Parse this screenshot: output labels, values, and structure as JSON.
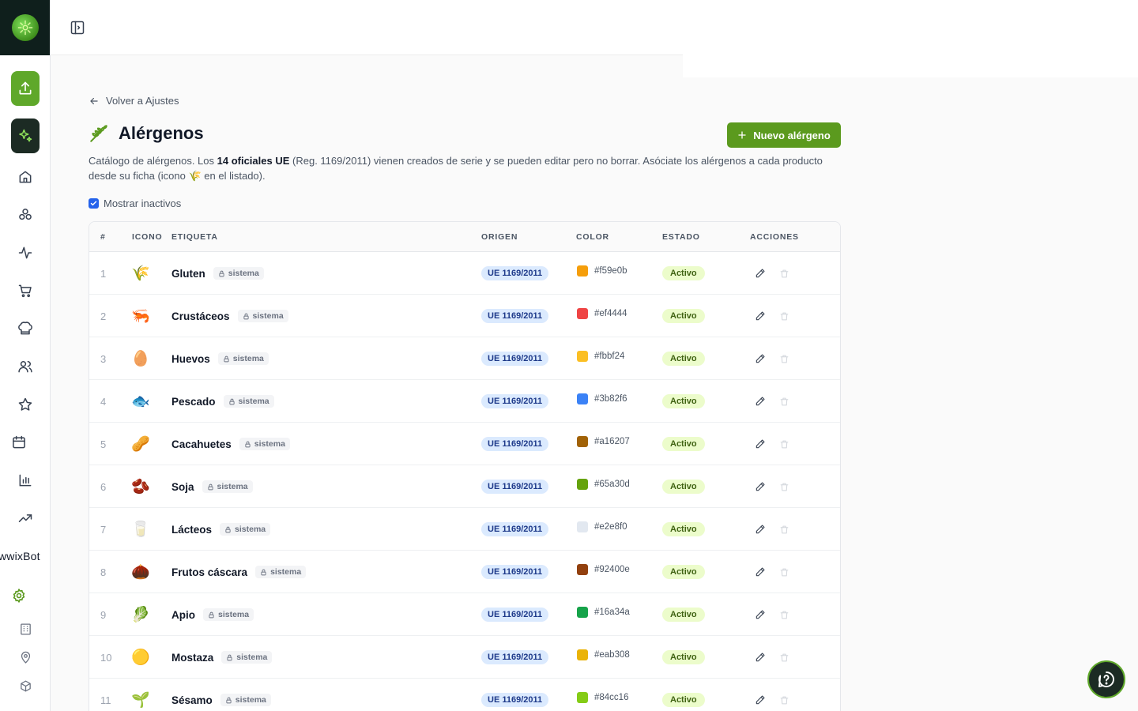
{
  "sidebar": {
    "brand_text": "wwixBot",
    "icons": [
      "upload-icon",
      "sparkles-icon",
      "home-icon",
      "boxes-icon",
      "activity-icon",
      "cart-icon",
      "chef-hat-icon",
      "users-icon",
      "star-icon",
      "calendar-icon",
      "bar-chart-icon",
      "trending-up-icon",
      "settings-icon",
      "building-icon",
      "location-pin-icon",
      "package-icon"
    ]
  },
  "main": {
    "back_label": "Volver a Ajustes",
    "title": "Alérgenos",
    "new_button_label": "Nuevo alérgeno",
    "description": {
      "part1": "Catálogo de alérgenos. Los ",
      "bold": "14 oficiales UE",
      "part2": " (Reg. 1169/2011) vienen creados de serie y se pueden editar pero no borrar. Asóciate los alérgenos a cada producto desde su ficha (icono ",
      "part3": " en el listado)."
    },
    "show_inactive_label": "Mostrar inactivos",
    "show_inactive_checked": true
  },
  "table": {
    "headers": {
      "num": "#",
      "icon": "ICONO",
      "label": "ETIQUETA",
      "origin": "ORIGEN",
      "color": "COLOR",
      "status": "ESTADO",
      "actions": "ACCIONES"
    },
    "rows": [
      {
        "num": "1",
        "emoji": "🌾",
        "label": "Gluten",
        "badge": "sistema",
        "origin": "UE 1169/2011",
        "color": "#f59e0b",
        "status": "Activo"
      },
      {
        "num": "2",
        "emoji": "🦐",
        "label": "Crustáceos",
        "badge": "sistema",
        "origin": "UE 1169/2011",
        "color": "#ef4444",
        "status": "Activo"
      },
      {
        "num": "3",
        "emoji": "🥚",
        "label": "Huevos",
        "badge": "sistema",
        "origin": "UE 1169/2011",
        "color": "#fbbf24",
        "status": "Activo"
      },
      {
        "num": "4",
        "emoji": "🐟",
        "label": "Pescado",
        "badge": "sistema",
        "origin": "UE 1169/2011",
        "color": "#3b82f6",
        "status": "Activo"
      },
      {
        "num": "5",
        "emoji": "🥜",
        "label": "Cacahuetes",
        "badge": "sistema",
        "origin": "UE 1169/2011",
        "color": "#a16207",
        "status": "Activo"
      },
      {
        "num": "6",
        "emoji": "🫘",
        "label": "Soja",
        "badge": "sistema",
        "origin": "UE 1169/2011",
        "color": "#65a30d",
        "status": "Activo"
      },
      {
        "num": "7",
        "emoji": "🥛",
        "label": "Lácteos",
        "badge": "sistema",
        "origin": "UE 1169/2011",
        "color": "#e2e8f0",
        "status": "Activo"
      },
      {
        "num": "8",
        "emoji": "🌰",
        "label": "Frutos cáscara",
        "badge": "sistema",
        "origin": "UE 1169/2011",
        "color": "#92400e",
        "status": "Activo"
      },
      {
        "num": "9",
        "emoji": "🥬",
        "label": "Apio",
        "badge": "sistema",
        "origin": "UE 1169/2011",
        "color": "#16a34a",
        "status": "Activo"
      },
      {
        "num": "10",
        "emoji": "🟡",
        "label": "Mostaza",
        "badge": "sistema",
        "origin": "UE 1169/2011",
        "color": "#eab308",
        "status": "Activo"
      },
      {
        "num": "11",
        "emoji": "🌱",
        "label": "Sésamo",
        "badge": "sistema",
        "origin": "UE 1169/2011",
        "color": "#84cc16",
        "status": "Activo"
      }
    ]
  },
  "colors": {
    "accent": "#5b9a1e",
    "sidebar_dark": "#1c2b24"
  }
}
